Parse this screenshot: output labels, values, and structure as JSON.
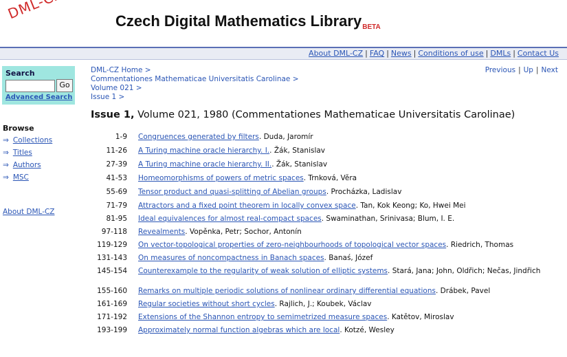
{
  "header": {
    "logo_text": "DML-CZ",
    "title": "Czech Digital Mathematics Library",
    "beta": "BETA"
  },
  "topnav": {
    "links": [
      "About DML-CZ",
      "FAQ",
      "News",
      "Conditions of use",
      "DMLs",
      "Contact Us"
    ]
  },
  "sidebar": {
    "search_title": "Search",
    "search_placeholder": "",
    "go_label": "Go",
    "advanced_search": "Advanced Search",
    "browse_title": "Browse",
    "browse_items": [
      "Collections",
      "Titles",
      "Authors",
      "MSC"
    ],
    "about": "About DML-CZ"
  },
  "breadcrumbs": [
    "DML-CZ Home >",
    "Commentationes Mathematicae Universitatis Carolinae >",
    "Volume 021 >",
    "Issue 1 >"
  ],
  "pager": {
    "previous": "Previous",
    "up": "Up",
    "next": "Next"
  },
  "issue": {
    "bold": "Issue 1,",
    "rest": "Volume 021, 1980 (Commentationes Mathematicae Universitatis Carolinae)"
  },
  "articles": [
    {
      "pages": "1-9",
      "title": "Congruences generated by filters",
      "authors": "Duda, Jaromír"
    },
    {
      "pages": "11-26",
      "title": "A Turing machine oracle hierarchy. I.",
      "authors": "Žák, Stanislav"
    },
    {
      "pages": "27-39",
      "title": "A Turing machine oracle hierarchy. II.",
      "authors": "Žák, Stanislav"
    },
    {
      "pages": "41-53",
      "title": "Homeomorphisms of powers of metric spaces",
      "authors": "Trnková, Věra"
    },
    {
      "pages": "55-69",
      "title": "Tensor product and quasi-splitting of Abelian groups",
      "authors": "Procházka, Ladislav"
    },
    {
      "pages": "71-79",
      "title": "Attractors and a fixed point theorem in locally convex space",
      "authors": "Tan, Kok Keong; Ko, Hwei Mei"
    },
    {
      "pages": "81-95",
      "title": "Ideal equivalences for almost real-compact spaces",
      "authors": "Swaminathan, Srinivasa; Blum, I. E."
    },
    {
      "pages": "97-118",
      "title": "Revealments",
      "authors": "Vopěnka, Petr; Sochor, Antonín"
    },
    {
      "pages": "119-129",
      "title": "On vector-topological properties of zero-neighbourhoods of topological vector spaces",
      "authors": "Riedrich, Thomas"
    },
    {
      "pages": "131-143",
      "title": "On measures of noncompactness in Banach spaces",
      "authors": "Banaś, Józef"
    },
    {
      "pages": "145-154",
      "title": "Counterexample to the regularity of weak solution of elliptic systems",
      "authors": "Stará, Jana; John, Oldřich; Nečas, Jindřich"
    },
    {
      "pages": "155-160",
      "title": "Remarks on multiple periodic solutions of nonlinear ordinary differential equations",
      "authors": "Drábek, Pavel"
    },
    {
      "pages": "161-169",
      "title": "Regular societies without short cycles",
      "authors": "Rajlich, J.; Koubek, Václav"
    },
    {
      "pages": "171-192",
      "title": "Extensions of the Shannon entropy to semimetrized measure spaces",
      "authors": "Katětov, Miroslav"
    },
    {
      "pages": "193-199",
      "title": "Approximately normal function algebras which are local",
      "authors": "Kotzé, Wesley"
    }
  ],
  "colors": {
    "link": "#2a55b5",
    "search_bg": "#9fe6e0",
    "logo_red": "#d02a2a",
    "nav_line": "#5a6fb5"
  }
}
